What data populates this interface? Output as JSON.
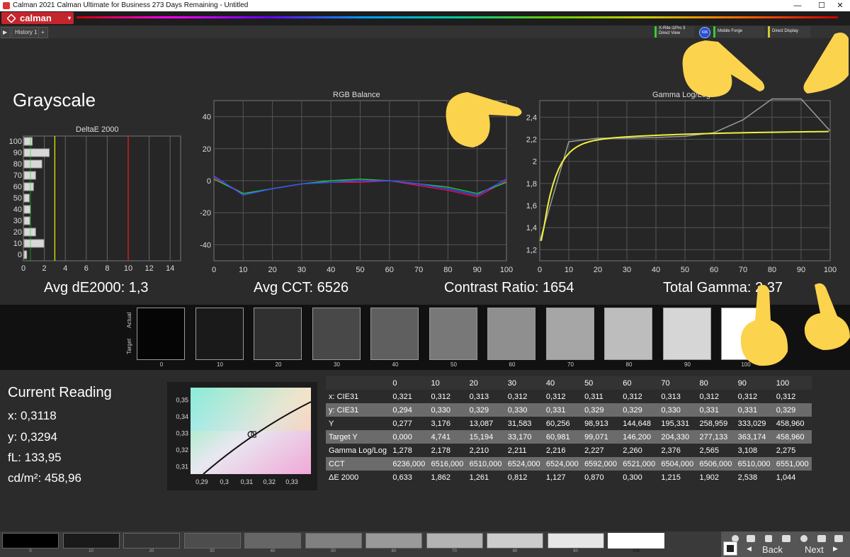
{
  "window": {
    "title": "Calman 2021 Calman Ultimate for Business 273 Days Remaining  - Untitled",
    "controls": [
      "—",
      "☐",
      "✕"
    ]
  },
  "menu": {
    "brand": "calman",
    "dropdown": "▾"
  },
  "tabs": {
    "history": "History 1"
  },
  "devices": {
    "meter_line1": "X-Rite i1Pro 3",
    "meter_line2": "Direct View",
    "meter_badge": "636",
    "source": "Mobile Forge",
    "display": "Direct Display"
  },
  "page_title": "Grayscale",
  "charts": [
    {
      "id": "deltae",
      "title": "DeltaE 2000",
      "type": "bar",
      "categories": [
        "100",
        "90",
        "80",
        "70",
        "60",
        "50",
        "40",
        "30",
        "20",
        "10",
        "0"
      ],
      "values": [
        0.78,
        2.4,
        1.7,
        1.1,
        0.9,
        0.5,
        0.6,
        0.55,
        1.1,
        1.9,
        0.25
      ],
      "xticks": [
        "0",
        "2",
        "4",
        "6",
        "8",
        "10",
        "12",
        "14"
      ],
      "xlim": [
        0,
        15
      ],
      "threshold_lines": [
        {
          "x": 3,
          "color": "#e6e600"
        },
        {
          "x": 10,
          "color": "#e02020"
        }
      ]
    },
    {
      "id": "rgb",
      "title": "RGB Balance",
      "type": "line",
      "x": [
        0,
        10,
        20,
        30,
        40,
        50,
        60,
        70,
        80,
        90,
        100
      ],
      "xticks": [
        "0",
        "10",
        "20",
        "30",
        "40",
        "50",
        "60",
        "70",
        "80",
        "90",
        "100"
      ],
      "yticks": [
        "40",
        "20",
        "0",
        "-20",
        "-40"
      ],
      "ylim": [
        -50,
        50
      ],
      "series": [
        {
          "color": "#e0105a",
          "values": [
            2,
            -8,
            -5,
            -2,
            -1,
            -1,
            0,
            -3,
            -6,
            -10,
            0
          ]
        },
        {
          "color": "#20c040",
          "values": [
            1,
            -8,
            -5,
            -2,
            0,
            1,
            0,
            -2,
            -4,
            -8,
            -1
          ]
        },
        {
          "color": "#3050ff",
          "values": [
            3,
            -9,
            -5,
            -2,
            -1,
            0,
            0,
            -2,
            -5,
            -9,
            1
          ]
        }
      ]
    },
    {
      "id": "gamma",
      "title": "Gamma Log/Log",
      "type": "line",
      "x": [
        0,
        10,
        20,
        30,
        40,
        50,
        60,
        70,
        80,
        90,
        100
      ],
      "xticks": [
        "0",
        "10",
        "20",
        "30",
        "40",
        "50",
        "60",
        "70",
        "80",
        "90",
        "100"
      ],
      "yticks": [
        "2,4",
        "2,2",
        "2",
        "1,8",
        "1,6",
        "1,4",
        "1,2"
      ],
      "ylim": [
        1.1,
        2.55
      ],
      "series": [
        {
          "color": "#9a9a9a",
          "values": [
            1.278,
            2.178,
            2.21,
            2.211,
            2.216,
            2.227,
            2.26,
            2.376,
            2.565,
            2.565,
            2.275
          ]
        },
        {
          "color": "#f0f040",
          "curve": "target"
        }
      ]
    }
  ],
  "stats": {
    "avg_de": "Avg dE2000: 1,3",
    "avg_cct": "Avg CCT: 6526",
    "contrast": "Contrast Ratio: 1654",
    "total_gamma": "Total Gamma: 2,37"
  },
  "swatches": {
    "row_labels": [
      "Actual",
      "Target"
    ],
    "levels": [
      "0",
      "10",
      "20",
      "30",
      "40",
      "50",
      "60",
      "70",
      "80",
      "90",
      "100"
    ],
    "colors": [
      "#050505",
      "#1a1a1a",
      "#303030",
      "#484848",
      "#5f5f5f",
      "#787878",
      "#8f8f8f",
      "#a6a6a6",
      "#bdbdbd",
      "#d6d6d6",
      "#ffffff"
    ]
  },
  "current_reading": {
    "title": "Current Reading",
    "x": "x: 0,3118",
    "y": "y: 0,3294",
    "fl": "fL: 133,95",
    "cdm2": "cd/m²: 458,96"
  },
  "cie_chart": {
    "yticks": [
      "0,35",
      "0,34",
      "0,33",
      "0,32",
      "0,31"
    ],
    "xticks": [
      "0,29",
      "0,3",
      "0,31",
      "0,32",
      "0,33"
    ],
    "point": {
      "x": 0.3118,
      "y": 0.3294
    }
  },
  "table": {
    "columns": [
      "",
      "0",
      "10",
      "20",
      "30",
      "40",
      "50",
      "60",
      "70",
      "80",
      "90",
      "100"
    ],
    "rows": [
      {
        "label": "x: CIE31",
        "values": [
          "0,321",
          "0,312",
          "0,313",
          "0,312",
          "0,312",
          "0,311",
          "0,312",
          "0,313",
          "0,312",
          "0,312",
          "0,312"
        ]
      },
      {
        "label": "y: CIE31",
        "values": [
          "0,294",
          "0,330",
          "0,329",
          "0,330",
          "0,331",
          "0,329",
          "0,329",
          "0,330",
          "0,331",
          "0,331",
          "0,329"
        ]
      },
      {
        "label": "Y",
        "values": [
          "0,277",
          "3,176",
          "13,087",
          "31,583",
          "60,256",
          "98,913",
          "144,648",
          "195,331",
          "258,959",
          "333,029",
          "458,960"
        ]
      },
      {
        "label": "Target Y",
        "values": [
          "0,000",
          "4,741",
          "15,194",
          "33,170",
          "60,981",
          "99,071",
          "146,200",
          "204,330",
          "277,133",
          "363,174",
          "458,960"
        ]
      },
      {
        "label": "Gamma Log/Log",
        "values": [
          "1,278",
          "2,178",
          "2,210",
          "2,211",
          "2,216",
          "2,227",
          "2,260",
          "2,376",
          "2,565",
          "3,108",
          "2,275"
        ]
      },
      {
        "label": "CCT",
        "values": [
          "6236,000",
          "6516,000",
          "6510,000",
          "6524,000",
          "6524,000",
          "6592,000",
          "6521,000",
          "6504,000",
          "6506,000",
          "6510,000",
          "6551,000"
        ]
      },
      {
        "label": "ΔE 2000",
        "values": [
          "0,633",
          "1,862",
          "1,261",
          "0,812",
          "1,127",
          "0,870",
          "0,300",
          "1,215",
          "1,902",
          "2,538",
          "1,044"
        ]
      }
    ]
  },
  "bottom_swatches": [
    "0",
    "10",
    "20",
    "30",
    "40",
    "50",
    "60",
    "70",
    "80",
    "90",
    "100"
  ],
  "nav": {
    "back": "Back",
    "next": "Next"
  }
}
